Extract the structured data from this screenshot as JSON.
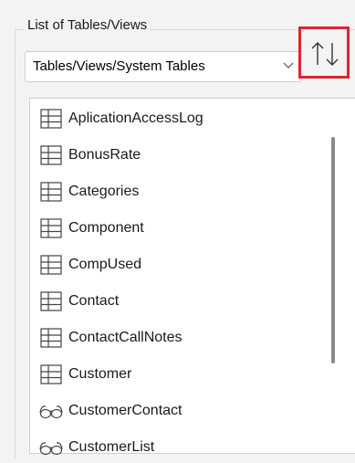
{
  "group": {
    "title": "List of Tables/Views"
  },
  "filter": {
    "selected": "Tables/Views/System Tables"
  },
  "sort_button": {
    "icon": "sort-up-down-icon",
    "highlight_color": "#e0242c"
  },
  "items": [
    {
      "label": "AplicationAccessLog",
      "icon": "table-grid-icon"
    },
    {
      "label": "BonusRate",
      "icon": "table-grid-icon"
    },
    {
      "label": "Categories",
      "icon": "table-grid-icon"
    },
    {
      "label": "Component",
      "icon": "table-grid-icon"
    },
    {
      "label": "CompUsed",
      "icon": "table-grid-icon"
    },
    {
      "label": "Contact",
      "icon": "table-grid-icon"
    },
    {
      "label": "ContactCallNotes",
      "icon": "table-grid-icon"
    },
    {
      "label": "Customer",
      "icon": "table-grid-icon"
    },
    {
      "label": "CustomerContact",
      "icon": "view-glasses-icon"
    },
    {
      "label": "CustomerList",
      "icon": "view-glasses-icon"
    }
  ]
}
